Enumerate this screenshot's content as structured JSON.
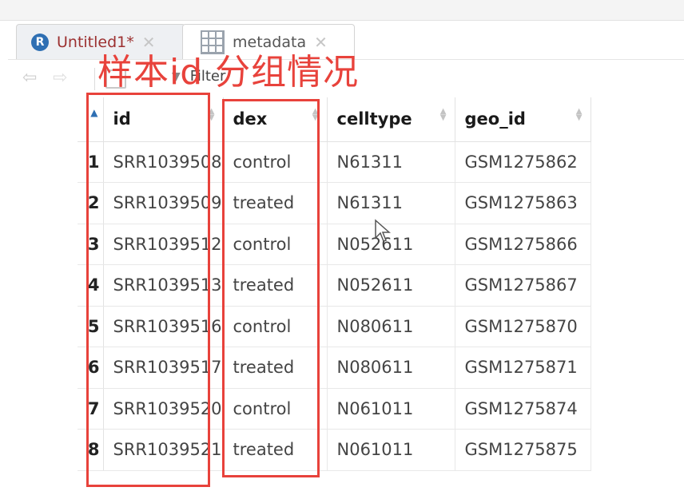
{
  "tabs": [
    {
      "label": "Untitled1*",
      "icon": "r-script-icon"
    },
    {
      "label": "metadata",
      "icon": "table-grid-icon"
    }
  ],
  "toolbar": {
    "filter_label": "Filter"
  },
  "annotation": {
    "text": "样本id 分组情况",
    "color": "#e8423b"
  },
  "table": {
    "columns": [
      "id",
      "dex",
      "celltype",
      "geo_id"
    ],
    "rows": [
      {
        "rn": "1",
        "id": "SRR1039508",
        "dex": "control",
        "celltype": "N61311",
        "geo_id": "GSM1275862"
      },
      {
        "rn": "2",
        "id": "SRR1039509",
        "dex": "treated",
        "celltype": "N61311",
        "geo_id": "GSM1275863"
      },
      {
        "rn": "3",
        "id": "SRR1039512",
        "dex": "control",
        "celltype": "N052611",
        "geo_id": "GSM1275866"
      },
      {
        "rn": "4",
        "id": "SRR1039513",
        "dex": "treated",
        "celltype": "N052611",
        "geo_id": "GSM1275867"
      },
      {
        "rn": "5",
        "id": "SRR1039516",
        "dex": "control",
        "celltype": "N080611",
        "geo_id": "GSM1275870"
      },
      {
        "rn": "6",
        "id": "SRR1039517",
        "dex": "treated",
        "celltype": "N080611",
        "geo_id": "GSM1275871"
      },
      {
        "rn": "7",
        "id": "SRR1039520",
        "dex": "control",
        "celltype": "N061011",
        "geo_id": "GSM1275874"
      },
      {
        "rn": "8",
        "id": "SRR1039521",
        "dex": "treated",
        "celltype": "N061011",
        "geo_id": "GSM1275875"
      }
    ]
  }
}
